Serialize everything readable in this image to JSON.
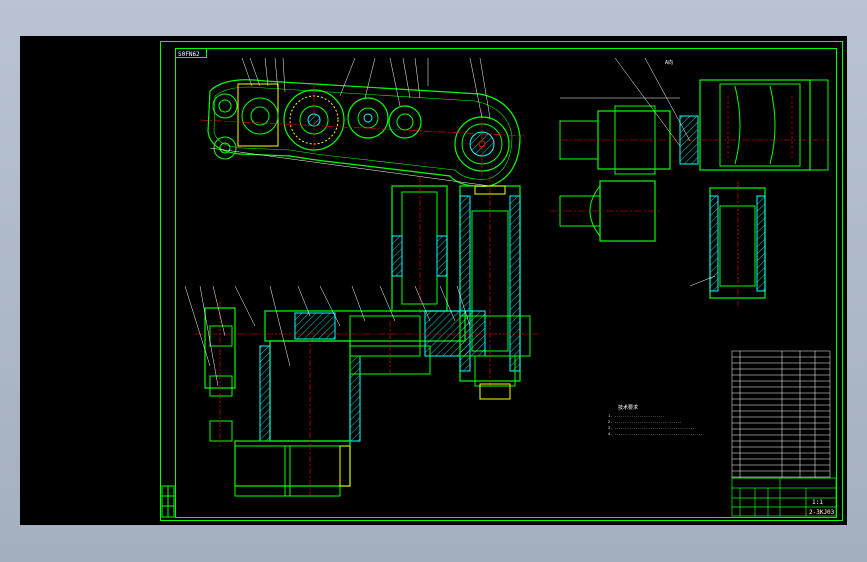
{
  "drawing": {
    "tag_label": "S0FN62",
    "tech_requirements_title": "技术要求",
    "tech_requirements_lines": [
      "1. ........................",
      "2. ................................",
      "3. ......................................",
      "4. .........................................."
    ],
    "view_label": "A向"
  },
  "title_block": {
    "scale": "1:1",
    "drawing_number": "2-3KJ03"
  },
  "colors": {
    "background": "#000000",
    "frame": "#00ff00",
    "part_outline": "#00ff00",
    "centerline": "#ff0000",
    "hatch": "#00ffff",
    "annotation": "#ffffff",
    "highlight": "#ffff00",
    "window": "#b9c3d1"
  }
}
